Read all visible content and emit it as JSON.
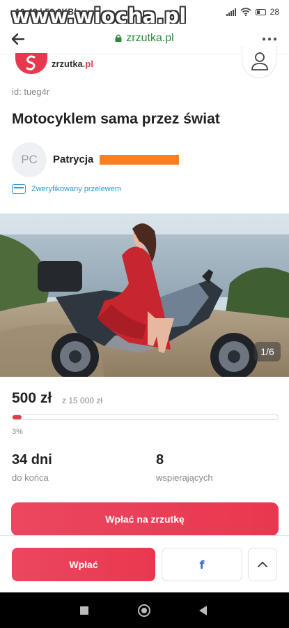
{
  "status_bar": {
    "time": "10:48 | 58,0KB/s",
    "battery": "28"
  },
  "watermark": "www.wiocha.pl",
  "browser": {
    "url": "zrzutka.pl"
  },
  "header": {
    "logo_text": "zrzutka",
    "logo_tld": ".pl"
  },
  "fundraiser": {
    "id_label": "id: tueg4r",
    "title": "Motocyklem sama przez świat",
    "owner_initials": "PC",
    "owner_name": "Patrycja",
    "verified_label": "Zweryfikowany przelewem",
    "photo_counter": "1/6",
    "raised": "500 zł",
    "goal": "z 15 000 zł",
    "progress_fraction": 0.033,
    "percent_label": "3%",
    "days_value": "34 dni",
    "days_label": "do końca",
    "backers_value": "8",
    "backers_label": "wspierających",
    "donate_main_label": "Wpłać na zrzutkę"
  },
  "bottom_bar": {
    "donate_label": "Wpłać",
    "facebook_glyph": "f"
  },
  "colors": {
    "brand": "#e8384f",
    "verified": "#2c97d6",
    "url_green": "#2c8a3c",
    "redaction": "#ff7f1f"
  }
}
